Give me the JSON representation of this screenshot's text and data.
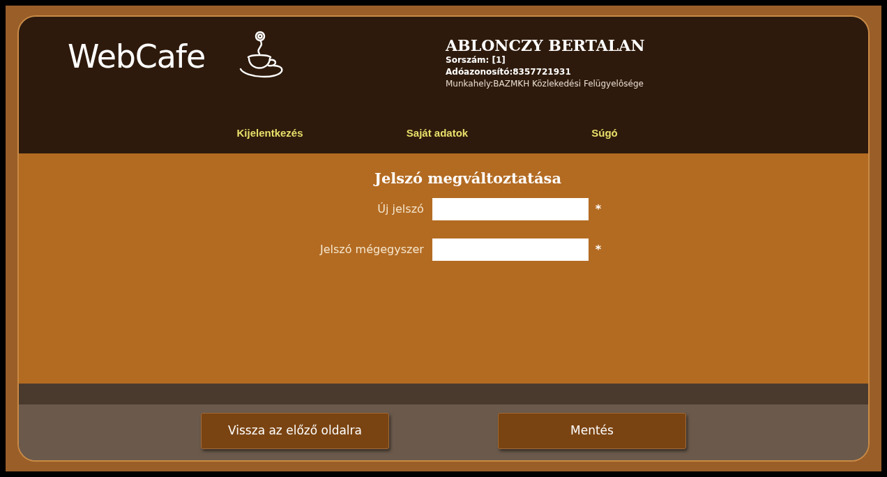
{
  "header": {
    "logo": "WebCafe",
    "user": {
      "name": "ABLONCZY BERTALAN",
      "details": [
        {
          "text": "Sorszám: [1]",
          "bold": true
        },
        {
          "text": "Adóazonosító:8357721931",
          "bold": true
        },
        {
          "text": "Munkahely:BAZMKH Közlekedési Felügyelôsége",
          "bold": false
        }
      ]
    }
  },
  "nav": [
    {
      "label": "Kijelentkezés"
    },
    {
      "label": "Saját adatok"
    },
    {
      "label": "Súgó"
    }
  ],
  "form": {
    "title": "Jelszó megváltoztatása",
    "fields": [
      {
        "label": "Új jelszó",
        "required": "*"
      },
      {
        "label": "Jelszó mégegyszer",
        "required": "*"
      }
    ]
  },
  "buttons": [
    {
      "label": "Vissza az előző oldalra"
    },
    {
      "label": "Mentés"
    }
  ]
}
